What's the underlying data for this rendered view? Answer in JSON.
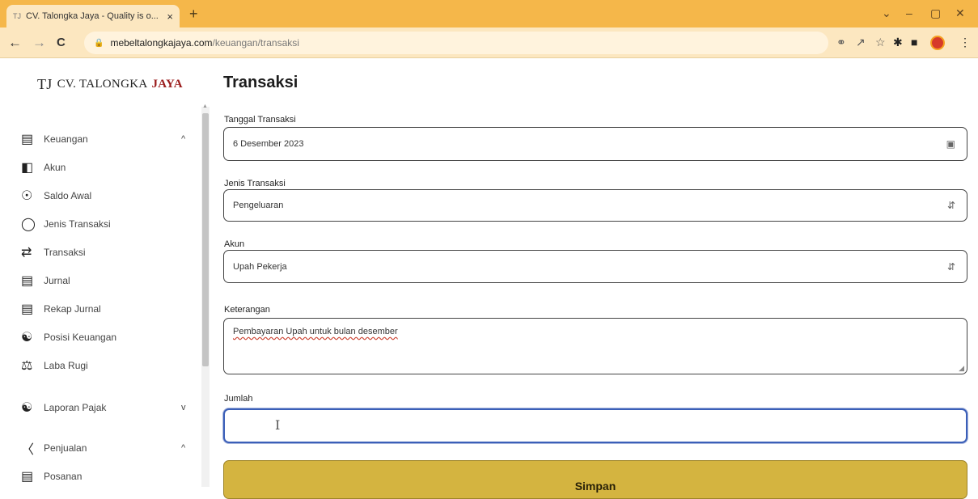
{
  "browser": {
    "tab_favicon": "TJ",
    "tab_title": "CV. Talongka Jaya - Quality is o...",
    "tab_close": "×",
    "new_tab": "+",
    "controls": [
      "⌄",
      "–",
      "▢",
      "✕"
    ],
    "url_host": "mebeltalongkajaya.com",
    "url_path": "/keuangan/transaksi",
    "nav": [
      "←",
      "→",
      "C"
    ],
    "tool_icons": [
      "key-icon",
      "share-icon",
      "star-icon",
      "extensions-icon",
      "sidepanel-icon",
      "profile-icon",
      "menu-icon"
    ]
  },
  "brand": {
    "mark": "TJ",
    "name": "CV. TALONGKA",
    "accent": "JAYA",
    "accent_color": "#9b1c1c"
  },
  "sidebar": {
    "items": [
      {
        "label": "Keuangan",
        "icon": "money-icon",
        "chevron": "^"
      },
      {
        "label": "Akun",
        "icon": "ledger-icon"
      },
      {
        "label": "Saldo Awal",
        "icon": "coin-icon"
      },
      {
        "label": "Jenis Transaksi",
        "icon": "coin-outline-icon"
      },
      {
        "label": "Transaksi",
        "icon": "transfer-icon"
      },
      {
        "label": "Jurnal",
        "icon": "card-icon"
      },
      {
        "label": "Rekap Jurnal",
        "icon": "card-export-icon"
      },
      {
        "label": "Posisi Keuangan",
        "icon": "hand-coin-icon"
      },
      {
        "label": "Laba Rugi",
        "icon": "scale-icon"
      },
      {
        "label": "Laporan Pajak",
        "icon": "hand-coin-icon",
        "chevron": "v"
      },
      {
        "label": "Penjualan",
        "icon": "cart-icon",
        "chevron": "^"
      },
      {
        "label": "Posanan",
        "icon": "card-export-icon"
      }
    ]
  },
  "main": {
    "title": "Transaksi",
    "fields": {
      "tanggal": {
        "label": "Tanggal Transaksi",
        "value": "6 Desember 2023"
      },
      "jenis": {
        "label": "Jenis Transaksi",
        "value": "Pengeluaran"
      },
      "akun": {
        "label": "Akun",
        "value": "Upah Pekerja"
      },
      "keterangan": {
        "label": "Keterangan",
        "value": "Pembayaran Upah untuk bulan desember"
      },
      "jumlah": {
        "label": "Jumlah",
        "value": ""
      }
    },
    "submit_label": "Simpan"
  },
  "colors": {
    "tab_bar": "#f5b74a",
    "toolbar": "#fce7c0",
    "submit": "#d4b440",
    "focus": "#3b5fb8"
  }
}
